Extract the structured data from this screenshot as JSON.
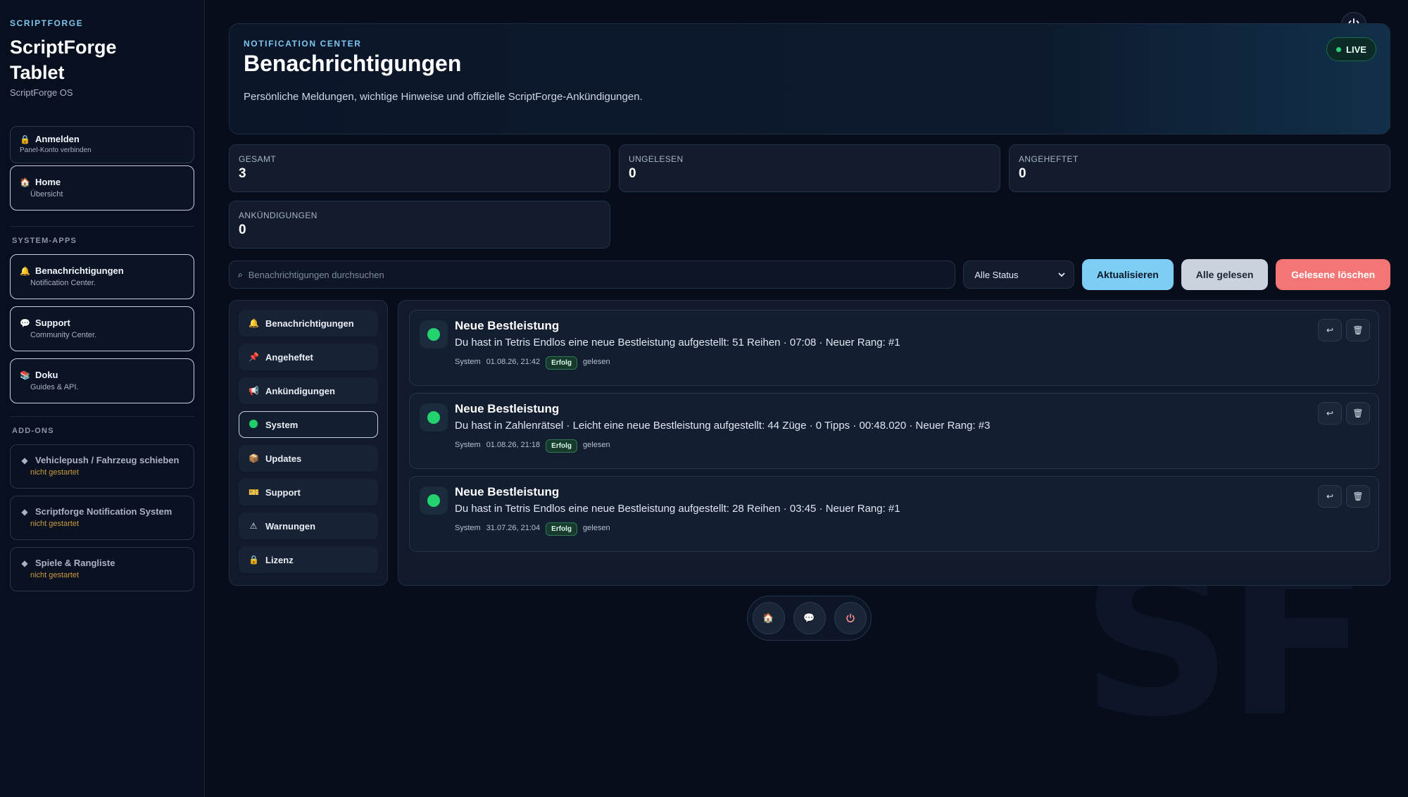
{
  "sidebar": {
    "kicker": "SCRIPTFORGE",
    "title_line1": "ScriptForge",
    "title_line2": "Tablet",
    "subtitle": "ScriptForge OS",
    "login": {
      "label": "Anmelden",
      "sub": "Panel-Konto verbinden",
      "icon": "lock-icon"
    },
    "home": {
      "label": "Home",
      "sub": "Übersicht",
      "icon": "house-icon"
    },
    "system_label": "SYSTEM-APPS",
    "system_apps": [
      {
        "label": "Benachrichtigungen",
        "sub": "Notification Center.",
        "icon": "bell-icon"
      },
      {
        "label": "Support",
        "sub": "Community Center.",
        "icon": "speech-bubble-icon"
      },
      {
        "label": "Doku",
        "sub": "Guides & API.",
        "icon": "books-icon"
      }
    ],
    "addons_label": "ADD-ONS",
    "addons": [
      {
        "label": "Vehiclepush / Fahrzeug schieben",
        "sub": "nicht gestartet",
        "icon": "diamond-icon"
      },
      {
        "label": "Scriptforge Notification System",
        "sub": "nicht gestartet",
        "icon": "diamond-icon"
      },
      {
        "label": "Spiele & Rangliste",
        "sub": "nicht gestartet",
        "icon": "diamond-icon"
      }
    ]
  },
  "hero": {
    "kicker": "NOTIFICATION CENTER",
    "title": "Benachrichtigungen",
    "description": "Persönliche Meldungen, wichtige Hinweise und offizielle ScriptForge-Ankündigungen.",
    "live": "LIVE"
  },
  "stats": [
    {
      "label": "GESAMT",
      "value": "3"
    },
    {
      "label": "UNGELESEN",
      "value": "0"
    },
    {
      "label": "ANGEHEFTET",
      "value": "0"
    },
    {
      "label": "ANKÜNDIGUNGEN",
      "value": "0"
    }
  ],
  "toolbar": {
    "search_placeholder": "Benachrichtigungen durchsuchen",
    "status_select": "Alle Status",
    "refresh": "Aktualisieren",
    "mark_all_read": "Alle gelesen",
    "delete_read": "Gelesene löschen"
  },
  "categories": [
    {
      "label": "Benachrichtigungen",
      "icon": "bell-icon"
    },
    {
      "label": "Angeheftet",
      "icon": "pin-icon"
    },
    {
      "label": "Ankündigungen",
      "icon": "megaphone-icon"
    },
    {
      "label": "System",
      "icon": "green-dot-icon"
    },
    {
      "label": "Updates",
      "icon": "package-icon"
    },
    {
      "label": "Support",
      "icon": "ticket-icon"
    },
    {
      "label": "Warnungen",
      "icon": "warning-icon"
    },
    {
      "label": "Lizenz",
      "icon": "lock-icon"
    }
  ],
  "notifications": [
    {
      "title": "Neue Bestleistung",
      "body": "Du hast in Tetris Endlos eine neue Bestleistung aufgestellt: 51 Reihen · 07:08 · Neuer Rang: #1",
      "source": "System",
      "time": "01.08.26, 21:42",
      "badge": "Erfolg",
      "state": "gelesen"
    },
    {
      "title": "Neue Bestleistung",
      "body": "Du hast in Zahlenrätsel · Leicht eine neue Bestleistung aufgestellt: 44 Züge · 0 Tipps · 00:48.020 · Neuer Rang: #3",
      "source": "System",
      "time": "01.08.26, 21:18",
      "badge": "Erfolg",
      "state": "gelesen"
    },
    {
      "title": "Neue Bestleistung",
      "body": "Du hast in Tetris Endlos eine neue Bestleistung aufgestellt: 28 Reihen · 03:45 · Neuer Rang: #1",
      "source": "System",
      "time": "31.07.26, 21:04",
      "badge": "Erfolg",
      "state": "gelesen"
    }
  ],
  "watermark": "SF",
  "colors": {
    "accent": "#7dcdf4",
    "danger": "#f47575",
    "success": "#22d36e",
    "background": "#070d1a"
  }
}
